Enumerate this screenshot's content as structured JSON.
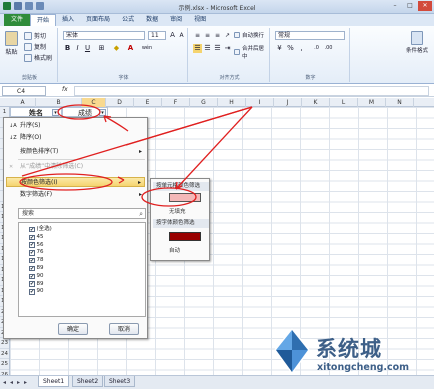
{
  "window": {
    "title": "示例.xlsx - Microsoft Excel"
  },
  "ribbon_tabs": [
    {
      "label": "文件",
      "kind": "file"
    },
    {
      "label": "开始",
      "kind": "active"
    },
    {
      "label": "插入",
      "kind": ""
    },
    {
      "label": "页面布局",
      "kind": ""
    },
    {
      "label": "公式",
      "kind": ""
    },
    {
      "label": "数据",
      "kind": ""
    },
    {
      "label": "审阅",
      "kind": ""
    },
    {
      "label": "视图",
      "kind": ""
    }
  ],
  "ribbon": {
    "clipboard": {
      "paste": "粘贴",
      "cut": "剪切",
      "copy": "复制",
      "format_painter": "格式刷",
      "label": "剪贴板"
    },
    "font": {
      "name": "宋体",
      "size": "11",
      "label": "字体",
      "bold": "B",
      "italic": "I",
      "underline": "U",
      "wen": "wén"
    },
    "alignment": {
      "wrap": "自动换行",
      "merge": "合并后居中",
      "label": "对齐方式"
    },
    "number": {
      "format": "常规",
      "label": "数字"
    },
    "styles": {
      "conditional": "条件格式"
    }
  },
  "formula_bar": {
    "name_box": "C4",
    "fx": "fx",
    "value": ""
  },
  "columns": [
    "A",
    "B",
    "C",
    "D",
    "E",
    "F",
    "G",
    "H",
    "I",
    "J",
    "K",
    "L",
    "M",
    "N"
  ],
  "rows": [
    "1",
    "2",
    "3",
    "4",
    "5",
    "6",
    "7",
    "8",
    "9",
    "10",
    "11",
    "12",
    "13",
    "14",
    "15",
    "16",
    "17",
    "18",
    "19",
    "20",
    "21",
    "22",
    "23",
    "24",
    "25",
    "26",
    "27",
    "28"
  ],
  "cells": {
    "a1": "姓名",
    "b1": "成绩"
  },
  "filter_menu": {
    "sort_asc": "升序(S)",
    "sort_desc": "降序(O)",
    "sort_color": "按颜色排序(T)",
    "clear_filter": "从“成绩”中清除筛选(C)",
    "filter_color": "按颜色筛选(I)",
    "number_filter": "数字筛选(F)",
    "search_placeholder": "搜索",
    "items": [
      {
        "label": "(全选)",
        "checked": "✔"
      },
      {
        "label": "45",
        "checked": "✔"
      },
      {
        "label": "56",
        "checked": "✔"
      },
      {
        "label": "76",
        "checked": "✔"
      },
      {
        "label": "78",
        "checked": "✔"
      },
      {
        "label": "89",
        "checked": "✔"
      },
      {
        "label": "90",
        "checked": "✔"
      },
      {
        "label": "89",
        "checked": "✔"
      },
      {
        "label": "90",
        "checked": "✔"
      }
    ],
    "ok": "确定",
    "cancel": "取消"
  },
  "color_submenu": {
    "by_cell_color": "按单元格颜色筛选",
    "no_fill": "无填充",
    "by_font_color": "按字体颜色筛选",
    "auto": "自动",
    "cell_color": "#f4b8b8",
    "font_color": "#990000"
  },
  "sheet_tabs": [
    "Sheet1",
    "Sheet2",
    "Sheet3"
  ],
  "watermark": {
    "name": "系统城",
    "url": "xitongcheng.com"
  },
  "colors": {
    "annotation": "#e02020",
    "ribbon_file": "#2f8c3a",
    "highlight": "#f5d46f",
    "logo": "#3d5f88"
  }
}
